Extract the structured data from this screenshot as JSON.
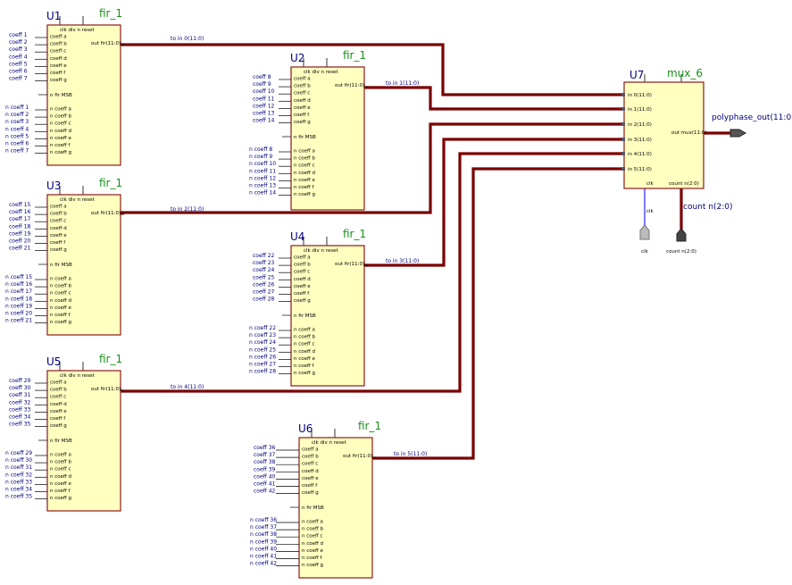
{
  "colors": {
    "block_fill": "#ffffc0",
    "block_stroke": "#8b1a1a",
    "wire": "#7a0000",
    "clk_wire": "#8080ff",
    "label": "#00007a",
    "module": "#1a8f1a"
  },
  "fir_pins": {
    "top": [
      "clk",
      "div",
      "n",
      "reset"
    ],
    "out": "out fir(11:0)",
    "msb": "n fir MSB",
    "letters": [
      "a",
      "b",
      "c",
      "d",
      "e",
      "f",
      "g"
    ],
    "coeff_prefix": "coeff",
    "ncoeff_prefix": "n coeff"
  },
  "instances": [
    {
      "name": "U1",
      "module": "fir_1",
      "coeffs": [
        "1",
        "2",
        "3",
        "4",
        "5",
        "6",
        "7"
      ],
      "net": "to in 0(11:0)"
    },
    {
      "name": "U2",
      "module": "fir_1",
      "coeffs": [
        "8",
        "9",
        "10",
        "11",
        "12",
        "13",
        "14"
      ],
      "net": "to in 1(11:0)"
    },
    {
      "name": "U3",
      "module": "fir_1",
      "coeffs": [
        "15",
        "16",
        "17",
        "18",
        "19",
        "20",
        "21"
      ],
      "net": "to in 2(11:0)"
    },
    {
      "name": "U4",
      "module": "fir_1",
      "coeffs": [
        "22",
        "23",
        "24",
        "25",
        "26",
        "27",
        "28"
      ],
      "net": "to in 3(11:0)"
    },
    {
      "name": "U5",
      "module": "fir_1",
      "coeffs": [
        "29",
        "30",
        "31",
        "32",
        "33",
        "34",
        "35"
      ],
      "net": "to in 4(11:0)"
    },
    {
      "name": "U6",
      "module": "fir_1",
      "coeffs": [
        "36",
        "37",
        "38",
        "39",
        "40",
        "41",
        "42"
      ],
      "net": "to in 5(11:0)"
    }
  ],
  "mux": {
    "name": "U7",
    "module": "mux_6",
    "inputs": [
      "in 0(11:0)",
      "in 1(11:0)",
      "in 2(11:0)",
      "in 3(11:0)",
      "in 4(11:0)",
      "in 5(11:0)"
    ],
    "out": "out mux(11:0)",
    "clk": "clk",
    "count": "count n(2:0)"
  },
  "ports": {
    "output_net": "polyphase_out(11:0)",
    "count_net": "count n(2:0)",
    "clk_net": "clk",
    "clk_port": "clk",
    "count_port": "count n(2:0)"
  }
}
